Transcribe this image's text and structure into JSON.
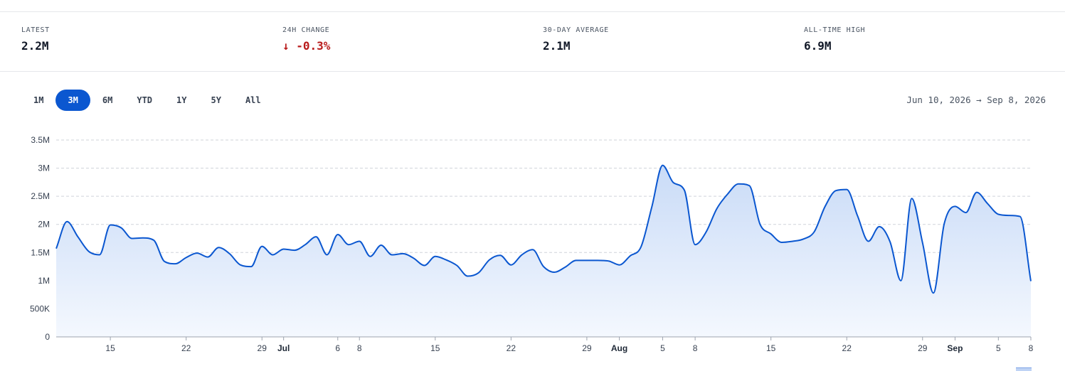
{
  "stats": [
    {
      "label": "LATEST",
      "value": "2.2M"
    },
    {
      "label": "24H CHANGE",
      "value": "↓ -0.3%"
    },
    {
      "label": "30-DAY AVERAGE",
      "value": "2.1M"
    },
    {
      "label": "ALL-TIME HIGH",
      "value": "6.9M"
    }
  ],
  "ranges": [
    "1M",
    "3M",
    "6M",
    "YTD",
    "1Y",
    "5Y",
    "All"
  ],
  "active_range": "3M",
  "date_range": "Jun 10, 2026 → Sep 8, 2026",
  "colors": {
    "line": "#0b57d0",
    "fill_top": "#c9dbf7",
    "fill_bottom": "#f4f8fe",
    "grid": "#cfd3da",
    "negative": "#b91c1c",
    "active_tab": "#0b57d0"
  },
  "chart_data": {
    "type": "area",
    "title": "",
    "xlabel": "",
    "ylabel": "",
    "ylim": [
      0,
      3500000
    ],
    "y_ticks": [
      0,
      500000,
      1000000,
      1500000,
      2000000,
      2500000,
      3000000,
      3500000
    ],
    "y_tick_labels": [
      "0",
      "500K",
      "1M",
      "1.5M",
      "2M",
      "2.5M",
      "3M",
      "3.5M"
    ],
    "x_range": [
      "2026-06-10",
      "2026-09-08"
    ],
    "x_ticks": [
      {
        "date": "2026-06-15",
        "label": "15",
        "month": false
      },
      {
        "date": "2026-06-22",
        "label": "22",
        "month": false
      },
      {
        "date": "2026-06-29",
        "label": "29",
        "month": false
      },
      {
        "date": "2026-07-01",
        "label": "Jul",
        "month": true
      },
      {
        "date": "2026-07-06",
        "label": "6",
        "month": false
      },
      {
        "date": "2026-07-08",
        "label": "8",
        "month": false
      },
      {
        "date": "2026-07-15",
        "label": "15",
        "month": false
      },
      {
        "date": "2026-07-22",
        "label": "22",
        "month": false
      },
      {
        "date": "2026-07-29",
        "label": "29",
        "month": false
      },
      {
        "date": "2026-08-01",
        "label": "Aug",
        "month": true
      },
      {
        "date": "2026-08-05",
        "label": "5",
        "month": false
      },
      {
        "date": "2026-08-08",
        "label": "8",
        "month": false
      },
      {
        "date": "2026-08-15",
        "label": "15",
        "month": false
      },
      {
        "date": "2026-08-22",
        "label": "22",
        "month": false
      },
      {
        "date": "2026-08-29",
        "label": "29",
        "month": false
      },
      {
        "date": "2026-09-01",
        "label": "Sep",
        "month": true
      },
      {
        "date": "2026-09-05",
        "label": "5",
        "month": false
      },
      {
        "date": "2026-09-08",
        "label": "8",
        "month": false
      }
    ],
    "grid": true,
    "series": [
      {
        "points": [
          [
            "2026-06-10",
            1570000
          ],
          [
            "2026-06-11",
            2050000
          ],
          [
            "2026-06-12",
            1780000
          ],
          [
            "2026-06-13",
            1520000
          ],
          [
            "2026-06-14",
            1460000
          ],
          [
            "2026-06-15",
            1990000
          ],
          [
            "2026-06-16",
            1940000
          ],
          [
            "2026-06-17",
            1750000
          ],
          [
            "2026-06-18",
            1760000
          ],
          [
            "2026-06-19",
            1720000
          ],
          [
            "2026-06-20",
            1340000
          ],
          [
            "2026-06-21",
            1300000
          ],
          [
            "2026-06-22",
            1410000
          ],
          [
            "2026-06-23",
            1490000
          ],
          [
            "2026-06-24",
            1420000
          ],
          [
            "2026-06-25",
            1590000
          ],
          [
            "2026-06-26",
            1480000
          ],
          [
            "2026-06-27",
            1280000
          ],
          [
            "2026-06-28",
            1250000
          ],
          [
            "2026-06-29",
            1610000
          ],
          [
            "2026-06-30",
            1460000
          ],
          [
            "2026-07-01",
            1560000
          ],
          [
            "2026-07-02",
            1540000
          ],
          [
            "2026-07-03",
            1640000
          ],
          [
            "2026-07-04",
            1780000
          ],
          [
            "2026-07-05",
            1460000
          ],
          [
            "2026-07-06",
            1820000
          ],
          [
            "2026-07-07",
            1640000
          ],
          [
            "2026-07-08",
            1700000
          ],
          [
            "2026-07-09",
            1430000
          ],
          [
            "2026-07-10",
            1630000
          ],
          [
            "2026-07-11",
            1460000
          ],
          [
            "2026-07-12",
            1480000
          ],
          [
            "2026-07-13",
            1400000
          ],
          [
            "2026-07-14",
            1270000
          ],
          [
            "2026-07-15",
            1430000
          ],
          [
            "2026-07-16",
            1370000
          ],
          [
            "2026-07-17",
            1270000
          ],
          [
            "2026-07-18",
            1080000
          ],
          [
            "2026-07-19",
            1140000
          ],
          [
            "2026-07-20",
            1370000
          ],
          [
            "2026-07-21",
            1450000
          ],
          [
            "2026-07-22",
            1280000
          ],
          [
            "2026-07-23",
            1460000
          ],
          [
            "2026-07-24",
            1550000
          ],
          [
            "2026-07-25",
            1250000
          ],
          [
            "2026-07-26",
            1150000
          ],
          [
            "2026-07-27",
            1240000
          ],
          [
            "2026-07-28",
            1360000
          ],
          [
            "2026-07-29",
            1360000
          ],
          [
            "2026-07-30",
            1360000
          ],
          [
            "2026-07-31",
            1350000
          ],
          [
            "2026-08-01",
            1280000
          ],
          [
            "2026-08-02",
            1440000
          ],
          [
            "2026-08-03",
            1600000
          ],
          [
            "2026-08-04",
            2310000
          ],
          [
            "2026-08-05",
            3050000
          ],
          [
            "2026-08-06",
            2740000
          ],
          [
            "2026-08-07",
            2610000
          ],
          [
            "2026-08-08",
            1640000
          ],
          [
            "2026-08-09",
            1860000
          ],
          [
            "2026-08-10",
            2280000
          ],
          [
            "2026-08-11",
            2540000
          ],
          [
            "2026-08-12",
            2720000
          ],
          [
            "2026-08-13",
            2690000
          ],
          [
            "2026-08-14",
            2000000
          ],
          [
            "2026-08-15",
            1830000
          ],
          [
            "2026-08-16",
            1680000
          ],
          [
            "2026-08-17",
            1700000
          ],
          [
            "2026-08-18",
            1740000
          ],
          [
            "2026-08-19",
            1870000
          ],
          [
            "2026-08-20",
            2320000
          ],
          [
            "2026-08-21",
            2600000
          ],
          [
            "2026-08-22",
            2620000
          ],
          [
            "2026-08-23",
            2150000
          ],
          [
            "2026-08-24",
            1700000
          ],
          [
            "2026-08-25",
            1960000
          ],
          [
            "2026-08-26",
            1690000
          ],
          [
            "2026-08-27",
            1000000
          ],
          [
            "2026-08-28",
            2460000
          ],
          [
            "2026-08-29",
            1670000
          ],
          [
            "2026-08-30",
            780000
          ],
          [
            "2026-08-31",
            2010000
          ],
          [
            "2026-09-01",
            2320000
          ],
          [
            "2026-09-02",
            2210000
          ],
          [
            "2026-09-03",
            2570000
          ],
          [
            "2026-09-04",
            2370000
          ],
          [
            "2026-09-05",
            2180000
          ],
          [
            "2026-09-06",
            2160000
          ],
          [
            "2026-09-07",
            2140000
          ],
          [
            "2026-09-08",
            990000
          ]
        ]
      }
    ]
  }
}
